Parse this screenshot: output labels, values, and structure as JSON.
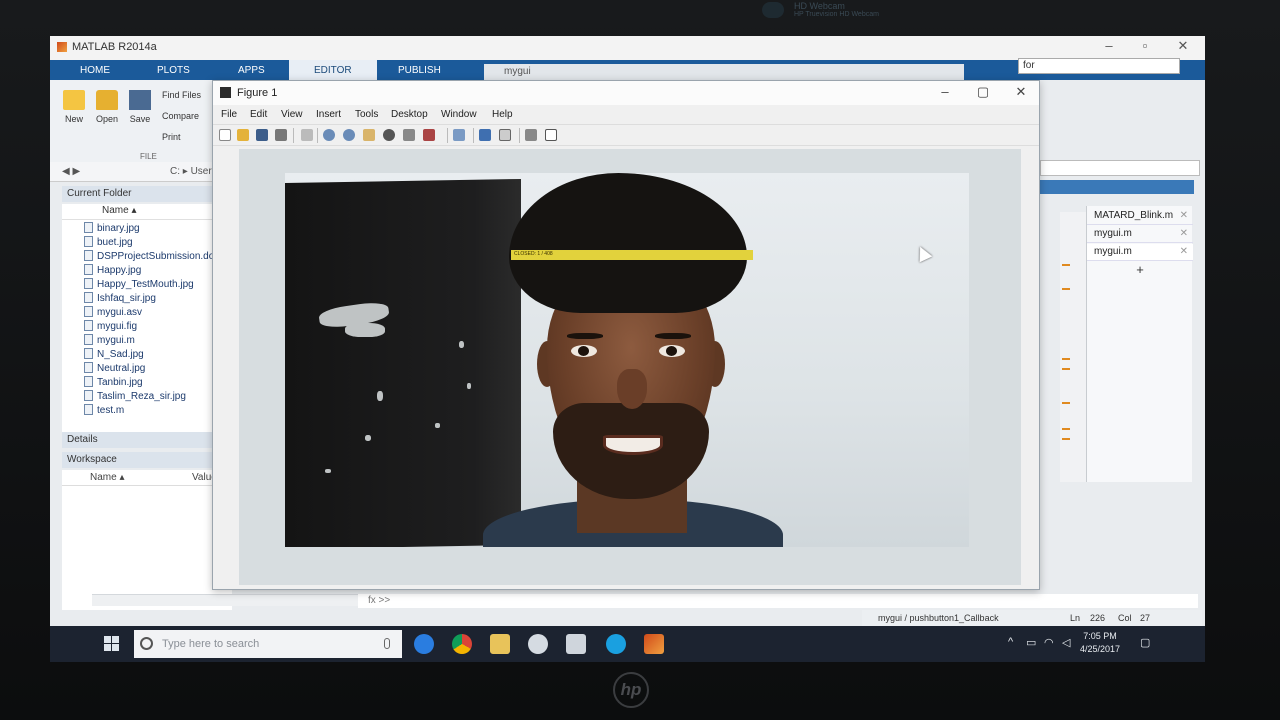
{
  "webcam": {
    "name": "HD Webcam",
    "sub": "HP Truevision HD Webcam"
  },
  "matlab": {
    "title": "MATLAB R2014a",
    "ribbon_tabs": [
      "HOME",
      "PLOTS",
      "APPS",
      "EDITOR",
      "PUBLISH"
    ],
    "ribbon_buttons": {
      "new": "New",
      "open": "Open",
      "save": "Save",
      "find_files": "Find Files",
      "compare": "Compare",
      "print": "Print",
      "group": "FILE"
    },
    "address": "C: ▸ User",
    "current_folder_title": "Current Folder",
    "file_column": "Name ▴",
    "files": [
      "binary.jpg",
      "buet.jpg",
      "DSPProjectSubmission.docx",
      "Happy.jpg",
      "Happy_TestMouth.jpg",
      "Ishfaq_sir.jpg",
      "mygui.asv",
      "mygui.fig",
      "mygui.m",
      "N_Sad.jpg",
      "Neutral.jpg",
      "Tanbin.jpg",
      "Taslim_Reza_sir.jpg",
      "test.m"
    ],
    "details_title": "Details",
    "workspace_title": "Workspace",
    "workspace_cols": {
      "name": "Name ▴",
      "value": "Value"
    },
    "command_prompt": "fx  >>",
    "search_value": "for",
    "bg_window_title": "mygui",
    "editor_tabs": [
      "MATARD_Blink.m",
      "mygui.m",
      "mygui.m"
    ],
    "status": {
      "function": "mygui / pushbutton1_Callback",
      "ln_label": "Ln",
      "ln": "226",
      "col_label": "Col",
      "col": "27"
    }
  },
  "figure": {
    "title": "Figure 1",
    "menu": [
      "File",
      "Edit",
      "View",
      "Insert",
      "Tools",
      "Desktop",
      "Window",
      "Help"
    ],
    "detection_label": "CLOSED: 1 / 408"
  },
  "taskbar": {
    "search_placeholder": "Type here to search",
    "time": "7:05 PM",
    "date": "4/25/2017"
  }
}
